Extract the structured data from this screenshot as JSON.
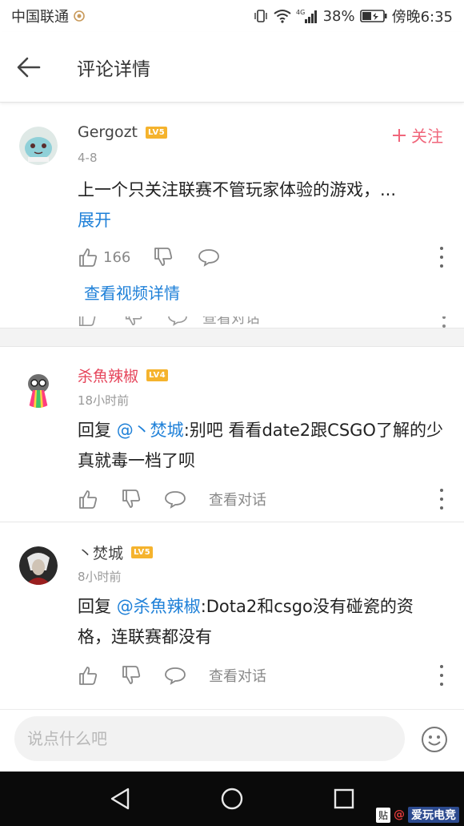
{
  "status_bar": {
    "carrier": "中国联通",
    "battery": "38%",
    "time": "傍晚6:35",
    "network": "4G"
  },
  "header": {
    "title": "评论详情"
  },
  "comments": [
    {
      "username": "Gergozt",
      "level": "LV5",
      "time": "4-8",
      "text": "上一个只关注联赛不管玩家体验的游戏，...",
      "expand": "展开",
      "likes": "166",
      "follow": "关注",
      "link": "查看视频详情"
    },
    {
      "username": "杀魚辣椒",
      "level": "LV4",
      "time": "18小时前",
      "reply_prefix": "回复 ",
      "mention": "@丶焚城",
      "text": ":别吧   看看date2跟CSGO了解的少真就毒一档了呗",
      "view_conversation": "查看对话"
    },
    {
      "username": "丶焚城",
      "level": "LV5",
      "time": "8小时前",
      "reply_prefix": "回复 ",
      "mention": "@杀魚辣椒",
      "text": ":Dota2和csgo没有碰瓷的资格，连联赛都没有",
      "view_conversation": "查看对话"
    }
  ],
  "peek_row": {
    "view_conversation": "查看对话"
  },
  "input": {
    "placeholder": "说点什么吧"
  },
  "watermark": {
    "tie": "贴",
    "text": "@",
    "logo": "爱玩电竞"
  },
  "colors": {
    "accent_red": "#e6455b",
    "link_blue": "#1e80d8",
    "badge_yellow": "#f5b32d"
  }
}
